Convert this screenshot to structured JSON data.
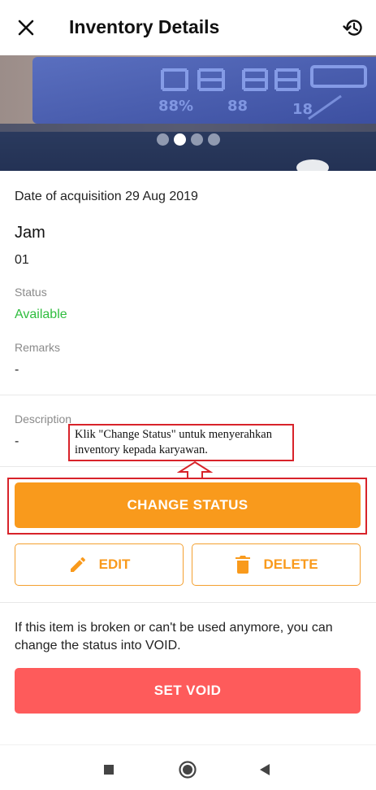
{
  "header": {
    "title": "Inventory Details",
    "close_icon": "close-icon",
    "history_icon": "history-icon"
  },
  "carousel": {
    "slide_count": 4,
    "active_index": 1
  },
  "item": {
    "acquisition": "Date of acquisition 29 Aug 2019",
    "name": "Jam",
    "code": "01",
    "status_label": "Status",
    "status_value": "Available",
    "remarks_label": "Remarks",
    "remarks_value": "-",
    "description_label": "Description",
    "description_value": "-"
  },
  "annotation": {
    "text": "Klik \"Change Status\" untuk menyerahkan inventory kepada karyawan."
  },
  "actions": {
    "change_status": "CHANGE STATUS",
    "edit": "EDIT",
    "delete": "DELETE"
  },
  "void_section": {
    "info": "If this item is broken or can't be used anymore, you can change the status into VOID.",
    "set_void": "SET VOID"
  },
  "colors": {
    "primary": "#f99a1c",
    "danger": "#fe5b5b",
    "status_available": "#2fbd3e",
    "annotation_border": "#d8232a"
  }
}
